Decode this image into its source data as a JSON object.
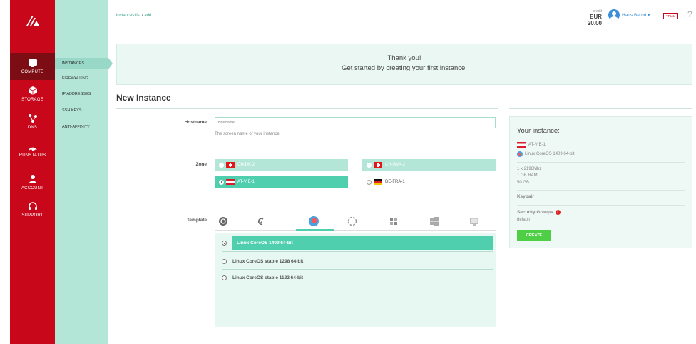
{
  "nav": {
    "items": [
      {
        "label": "COMPUTE",
        "icon": "monitor-icon"
      },
      {
        "label": "STORAGE",
        "icon": "box-icon"
      },
      {
        "label": "DNS",
        "icon": "network-icon"
      },
      {
        "label": "RUNSTATUS",
        "icon": "signal-icon"
      },
      {
        "label": "ACCOUNT",
        "icon": "user-icon"
      },
      {
        "label": "SUPPORT",
        "icon": "headset-icon"
      }
    ]
  },
  "subnav": {
    "items": [
      "INSTANCES",
      "FIREWALLING",
      "IP ADDRESSES",
      "SSH KEYS",
      "ANTI-AFFINITY"
    ]
  },
  "breadcrumb": {
    "link": "instances list",
    "sep": "/",
    "current": "add"
  },
  "header": {
    "credit_label": "credit",
    "credit_value": "EUR 20.00",
    "user": "Hans Bernd ▾",
    "trial": "TRIAL",
    "help": "?"
  },
  "banner": {
    "line1": "Thank you!",
    "line2": "Get started by creating your first instance!"
  },
  "form": {
    "title": "New Instance",
    "hostname_label": "Hostname",
    "hostname_placeholder": "Hostname",
    "hostname_help": "The screen name of your instance",
    "zone_label": "Zone",
    "zones": [
      "CH-DK-2",
      "CH-GVA-2",
      "AT-VIE-1",
      "DE-FRA-1"
    ],
    "template_label": "Template",
    "template_tabs": [
      "ubuntu-icon",
      "debian-icon",
      "coreos-icon",
      "centos-icon",
      "apps-icon",
      "windows-icon",
      "custom-icon"
    ],
    "templates": [
      "Linux CoreOS 1409 64-bit",
      "Linux CoreOS stable 1298 64-bit",
      "Linux CoreOS stable 1122 64-bit"
    ]
  },
  "summary": {
    "title": "Your instance:",
    "zone": "AT-VIE-1",
    "template": "Linux CoreOS 1409 64-bit",
    "cpu": "1 x 2198Mhz",
    "ram": "1 GB RAM",
    "disk": "50 GB",
    "keypair_label": "Keypair",
    "security_label": "Security Groups",
    "security_warn": "!",
    "security_value": "default",
    "create_label": "CREATE"
  },
  "colors": {
    "brand_red": "#c8071b",
    "accent_green": "#4fcfae",
    "create_green": "#4fcf45"
  }
}
